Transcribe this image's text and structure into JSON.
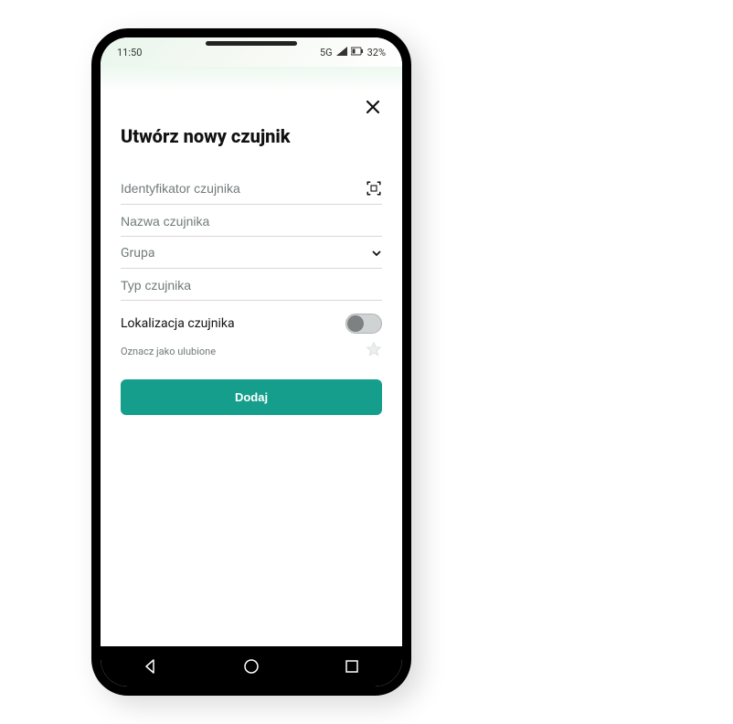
{
  "status": {
    "time": "11:50",
    "network": "5G",
    "battery": "32%"
  },
  "header": {
    "title": "Utwórz nowy czujnik"
  },
  "fields": {
    "sensor_id_placeholder": "Identyfikator czujnika",
    "sensor_name_placeholder": "Nazwa czujnika",
    "group_label": "Grupa",
    "sensor_type_placeholder": "Typ czujnika"
  },
  "options": {
    "location_label": "Lokalizacja czujnika",
    "favorite_label": "Oznacz jako ulubione"
  },
  "actions": {
    "add_label": "Dodaj"
  }
}
